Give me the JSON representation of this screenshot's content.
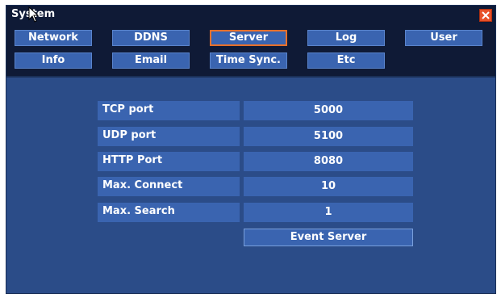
{
  "window": {
    "title": "System",
    "close_icon": "close-icon",
    "colors": {
      "background": "#2b4c88",
      "titlebar": "#0f1a36",
      "control": "#3a64b0",
      "active_border": "#e8702a",
      "close": "#e85028"
    }
  },
  "tabs": [
    {
      "label": "Network",
      "active": false
    },
    {
      "label": "DDNS",
      "active": false
    },
    {
      "label": "Server",
      "active": true
    },
    {
      "label": "Log",
      "active": false
    },
    {
      "label": "User",
      "active": false
    },
    {
      "label": "Info",
      "active": false
    },
    {
      "label": "Email",
      "active": false
    },
    {
      "label": "Time Sync.",
      "active": false
    },
    {
      "label": "Etc",
      "active": false
    }
  ],
  "settings": [
    {
      "label": "TCP port",
      "value": "5000"
    },
    {
      "label": "UDP port",
      "value": "5100"
    },
    {
      "label": "HTTP Port",
      "value": "8080"
    },
    {
      "label": "Max. Connect",
      "value": "10"
    },
    {
      "label": "Max. Search",
      "value": "1"
    }
  ],
  "actions": {
    "event_server_label": "Event Server"
  }
}
